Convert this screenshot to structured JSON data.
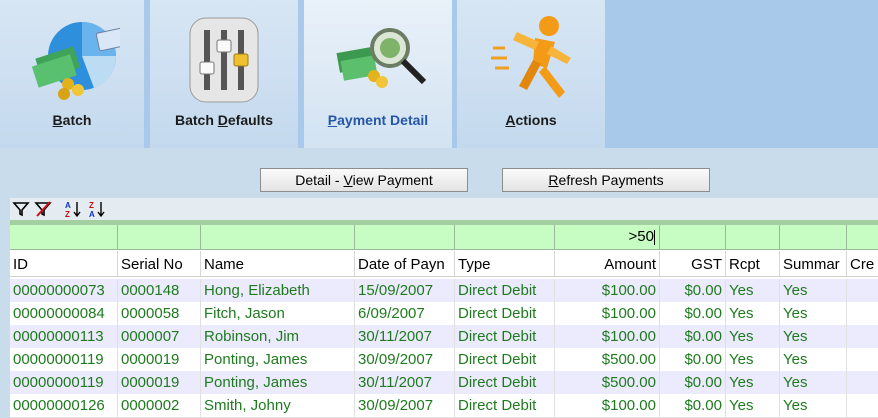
{
  "tabs": [
    {
      "label": "Batch",
      "icon": "money-chart-icon"
    },
    {
      "label": "Batch Defaults",
      "icon": "sliders-icon"
    },
    {
      "label": "Payment Detail",
      "icon": "magnifier-money-icon",
      "active": true
    },
    {
      "label": "Actions",
      "icon": "running-man-icon"
    }
  ],
  "buttons": {
    "view_payment": "Detail - View Payment",
    "refresh_payments": "Refresh Payments"
  },
  "grid_tools": [
    "filter-icon",
    "clear-filter-icon",
    "sort-ascending-icon",
    "sort-descending-icon"
  ],
  "filter": {
    "amount": ">50"
  },
  "columns": [
    "ID",
    "Serial No",
    "Name",
    "Date of Payn",
    "Type",
    "Amount",
    "GST",
    "Rcpt",
    "Summar",
    "Cre"
  ],
  "rows": [
    {
      "id": "00000000073",
      "serial": "0000148",
      "name": "Hong, Elizabeth",
      "date": "15/09/2007",
      "type": "Direct Debit",
      "amount": "$100.00",
      "gst": "$0.00",
      "rcpt": "Yes",
      "summary": "Yes"
    },
    {
      "id": "00000000084",
      "serial": "0000058",
      "name": "Fitch, Jason",
      "date": "6/09/2007",
      "type": "Direct Debit",
      "amount": "$100.00",
      "gst": "$0.00",
      "rcpt": "Yes",
      "summary": "Yes"
    },
    {
      "id": "00000000113",
      "serial": "0000007",
      "name": "Robinson, Jim",
      "date": "30/11/2007",
      "type": "Direct Debit",
      "amount": "$100.00",
      "gst": "$0.00",
      "rcpt": "Yes",
      "summary": "Yes"
    },
    {
      "id": "00000000119",
      "serial": "0000019",
      "name": "Ponting, James",
      "date": "30/09/2007",
      "type": "Direct Debit",
      "amount": "$500.00",
      "gst": "$0.00",
      "rcpt": "Yes",
      "summary": "Yes"
    },
    {
      "id": "00000000119",
      "serial": "0000019",
      "name": "Ponting, James",
      "date": "30/11/2007",
      "type": "Direct Debit",
      "amount": "$500.00",
      "gst": "$0.00",
      "rcpt": "Yes",
      "summary": "Yes"
    },
    {
      "id": "00000000126",
      "serial": "0000002",
      "name": "Smith, Johny",
      "date": "30/09/2007",
      "type": "Direct Debit",
      "amount": "$100.00",
      "gst": "$0.00",
      "rcpt": "Yes",
      "summary": "Yes"
    }
  ]
}
